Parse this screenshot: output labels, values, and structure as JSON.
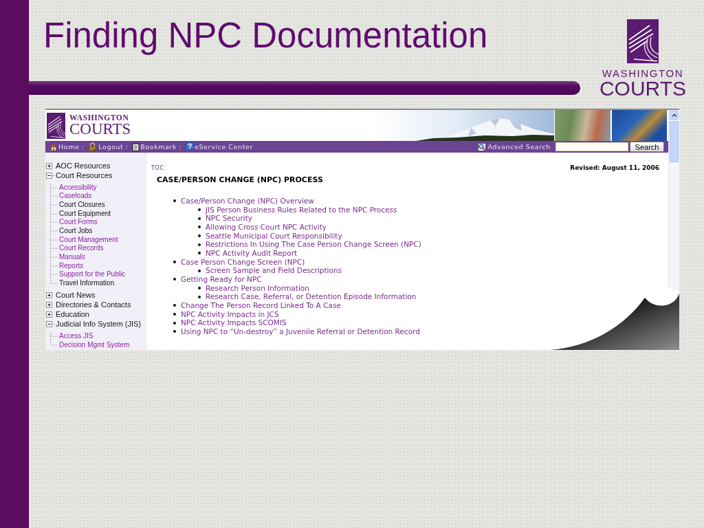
{
  "slide": {
    "title": "Finding NPC Documentation",
    "logo": {
      "line_1": "WASHINGTON",
      "line_2": "COURTS"
    }
  },
  "browser": {
    "logo": {
      "line_1": "WASHINGTON",
      "line_2": "COURTS"
    },
    "nav": {
      "items": [
        {
          "label": "Home",
          "separator": ":"
        },
        {
          "label": "Logout",
          "separator": ":"
        },
        {
          "label": "Bookmark",
          "separator": ":"
        },
        {
          "label": "eService Center"
        }
      ],
      "advanced_search": "Advanced Search",
      "search_button": "Search"
    },
    "sidebar": {
      "items": [
        {
          "label": "AOC Resources",
          "expanded": false
        },
        {
          "label": "Court Resources",
          "expanded": true,
          "children": [
            {
              "label": "Accessibility",
              "kind": "link"
            },
            {
              "label": "Caseloads",
              "kind": "link"
            },
            {
              "label": "Court Closures",
              "kind": "plain"
            },
            {
              "label": "Court Equipment",
              "kind": "plain"
            },
            {
              "label": "Court Forms",
              "kind": "link"
            },
            {
              "label": "Court Jobs",
              "kind": "plain"
            },
            {
              "label": "Court Management",
              "kind": "link"
            },
            {
              "label": "Court Records",
              "kind": "link"
            },
            {
              "label": "Manuals",
              "kind": "link"
            },
            {
              "label": "Reports",
              "kind": "link"
            },
            {
              "label": "Support for the Public",
              "kind": "link"
            },
            {
              "label": "Travel Information",
              "kind": "plain"
            }
          ]
        },
        {
          "label": "Court News",
          "expanded": false
        },
        {
          "label": "Directories & Contacts",
          "expanded": false
        },
        {
          "label": "Education",
          "expanded": false
        },
        {
          "label": "Judicial Info System (JIS)",
          "expanded": true,
          "children": [
            {
              "label": "Access JIS",
              "kind": "link"
            },
            {
              "label": "Decision Mgmt System",
              "kind": "link"
            }
          ]
        }
      ]
    },
    "content": {
      "toc_link": "TOC",
      "revised": "Revised: August 11, 2006",
      "heading": "CASE/PERSON CHANGE (NPC) PROCESS",
      "items": [
        {
          "label": "Case/Person Change (NPC) Overview",
          "children": [
            {
              "label": "JIS Person Business Rules Related to the NPC Process"
            },
            {
              "label": "NPC Security"
            },
            {
              "label": "Allowing Cross Court NPC Activity"
            },
            {
              "label": "Seattle Municipal Court Responsibility"
            },
            {
              "label": "Restrictions In Using The Case Person Change Screen (NPC)"
            },
            {
              "label": "NPC Activity Audit Report"
            }
          ]
        },
        {
          "label": "Case Person Change Screen (NPC)",
          "children": [
            {
              "label": "Screen Sample and Field Descriptions"
            }
          ]
        },
        {
          "label": "Getting Ready for NPC",
          "children": [
            {
              "label": "Research Person Information"
            },
            {
              "label": "Research Case, Referral, or Detention Episode Information"
            }
          ]
        },
        {
          "label": "Change The Person Record Linked To A Case"
        },
        {
          "label": "NPC Activity Impacts in JCS"
        },
        {
          "label": "NPC Activity Impacts SCOMIS"
        },
        {
          "label": "Using NPC to “Un-destroy” a Juvenile Referral or Detention Record"
        }
      ]
    }
  }
}
